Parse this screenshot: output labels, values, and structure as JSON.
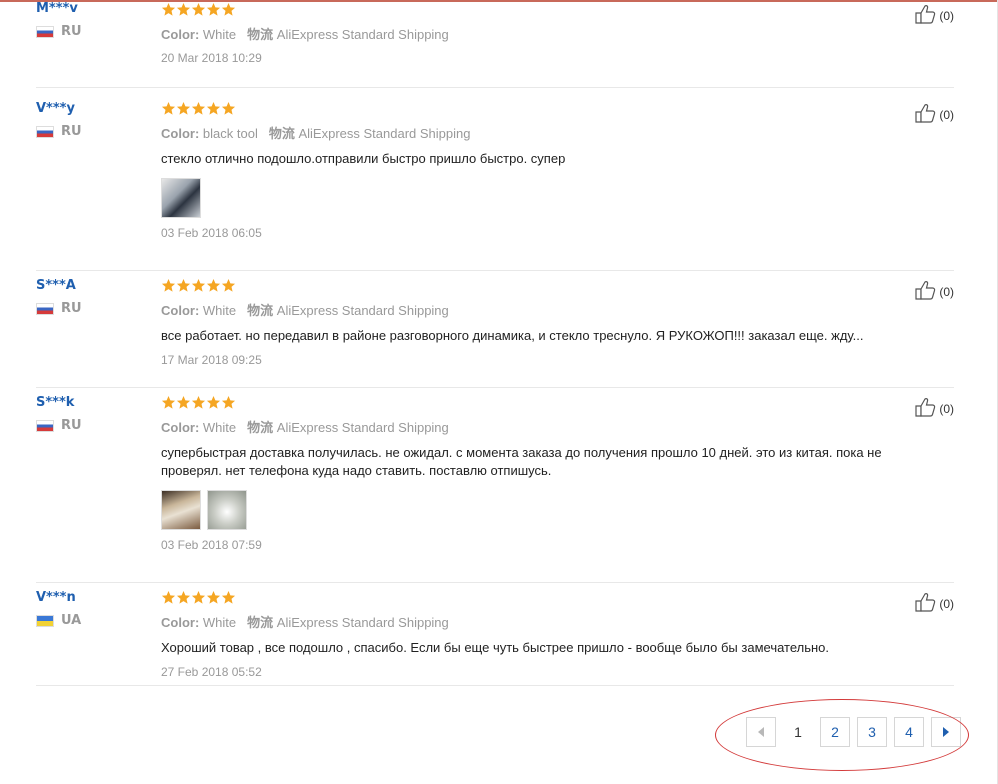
{
  "labels": {
    "color": "Color:",
    "shipping_label": "物流",
    "helpful_icon": "thumbs-up-icon"
  },
  "reviews": [
    {
      "user": "M***v",
      "country": "RU",
      "color": "White",
      "shipping": "AliExpress Standard Shipping",
      "text": "",
      "photos": 0,
      "date": "20 Mar 2018 10:29",
      "helpful": "(0)"
    },
    {
      "user": "V***y",
      "country": "RU",
      "color": "black tool",
      "shipping": "AliExpress Standard Shipping",
      "text": "стекло отлично подошло.отправили быстро пришло быстро. супер",
      "photos": 1,
      "date": "03 Feb 2018 06:05",
      "helpful": "(0)"
    },
    {
      "user": "S***A",
      "country": "RU",
      "color": "White",
      "shipping": "AliExpress Standard Shipping",
      "text": "все работает. но передавил в районе разговорного динамика, и стекло треснуло. Я РУКОЖОП!!! заказал еще. жду...",
      "photos": 0,
      "date": "17 Mar 2018 09:25",
      "helpful": "(0)"
    },
    {
      "user": "S***k",
      "country": "RU",
      "color": "White",
      "shipping": "AliExpress Standard Shipping",
      "text": "супербыстрая доставка получилась. не ожидал. с момента заказа до получения прошло 10 дней. это из китая. пока не проверял. нет телефона куда надо ставить. поставлю отпишусь.",
      "photos": 2,
      "date": "03 Feb 2018 07:59",
      "helpful": "(0)"
    },
    {
      "user": "V***n",
      "country": "UA",
      "color": "White",
      "shipping": "AliExpress Standard Shipping",
      "text": "Хороший товар , все подошло , спасибо. Если бы еще чуть быстрее пришло - вообще было бы замечательно.",
      "photos": 0,
      "date": "27 Feb 2018 05:52",
      "helpful": "(0)"
    }
  ],
  "rating": {
    "stars": 5,
    "star_color": "#f5a623"
  },
  "pagination": {
    "current": "1",
    "pages": [
      "2",
      "3",
      "4"
    ]
  },
  "colors": {
    "link": "#1f5faf",
    "highlight": "#d33a3a"
  }
}
